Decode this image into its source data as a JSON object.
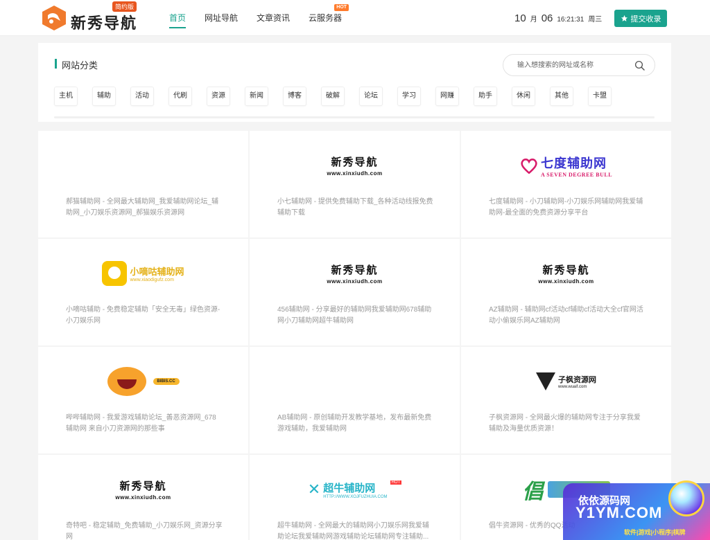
{
  "header": {
    "logo_text": "新秀导航",
    "logo_badge": "简约版",
    "nav": [
      {
        "label": "首页",
        "active": true,
        "hot": false
      },
      {
        "label": "网址导航",
        "active": false,
        "hot": false
      },
      {
        "label": "文章资讯",
        "active": false,
        "hot": false
      },
      {
        "label": "云服务器",
        "active": false,
        "hot": true
      }
    ],
    "hot_label": "HOT",
    "clock": {
      "month": "10",
      "month_unit": "月",
      "day": "06",
      "time": "16:21:31",
      "weekday": "周三"
    },
    "submit_label": "提交收录",
    "accent_color": "#1aa38e"
  },
  "categories": {
    "title": "网站分类",
    "search_placeholder": "输入想搜索的网址或名称",
    "tags": [
      "主机",
      "辅助",
      "活动",
      "代刷",
      "资源",
      "新闻",
      "博客",
      "破解",
      "论坛",
      "学习",
      "网赚",
      "助手",
      "休闲",
      "其他",
      "卡盟"
    ]
  },
  "sites": [
    {
      "logo": "",
      "desc": "郝猫辅助网 - 全网最大辅助网_我爱辅助网论坛_辅助网_小刀娱乐资源网_郝猫娱乐资源网"
    },
    {
      "logo": "xinxiu",
      "desc": "小七辅助网 - 提供免费辅助下载_各种活动线报免费辅助下载"
    },
    {
      "logo": "sevendegree",
      "desc": "七度辅助网 - 小刀辅助网-小刀娱乐网辅助网我爱辅助网-最全面的免费资源分享平台"
    },
    {
      "logo": "xiaodigu",
      "desc": "小嘀咕辅助 - 免费稳定辅助「安全无毒」绿色资源-小刀娱乐网"
    },
    {
      "logo": "xinxiu",
      "desc": "456辅助网 - 分享最好的辅助网我爱辅助网678辅助网小刀辅助网超牛辅助网"
    },
    {
      "logo": "xinxiu",
      "desc": "AZ辅助网 - 辅助网cf活动cf辅助cf活动大全cf官网活动小偷娱乐网AZ辅助网"
    },
    {
      "logo": "bibis",
      "desc": "哔哔辅助网 - 我爱游戏辅助论坛_善恶资源网_678辅助网 来自小刀资源网的那些事"
    },
    {
      "logo": "",
      "desc": "AB辅助网 - 原创辅助开发教学基地，发布最新免费游戏辅助，我爱辅助网"
    },
    {
      "logo": "zifeng",
      "desc": "子枫资源网 - 全网最火爆的辅助网专注于分享我爱辅助及海量优质资源！"
    },
    {
      "logo": "xinxiu",
      "desc": "奇特吧 - 稳定辅助_免费辅助_小刀娱乐网_资源分享网"
    },
    {
      "logo": "chaoniu",
      "desc": "超牛辅助网 - 全网最大的辅助网小刀娱乐网我爱辅助论坛我爱辅助网游戏辅助论坛辅助网专注辅助..."
    },
    {
      "logo": "jiniu",
      "desc": "倡牛资源网 - 优秀的QQ活动"
    }
  ],
  "brands": {
    "xinxiu": {
      "cn": "新秀导航",
      "url": "www.xinxiudh.com"
    },
    "sevendegree": {
      "cn": "七度辅助网",
      "en": "A SEVEN DEGREE BULL"
    },
    "xiaodigu": {
      "cn": "小嘀咕辅助网",
      "url": "www.xiaodigufz.com"
    },
    "bibis": {
      "tag": "BIBIS.CC"
    },
    "zifeng": {
      "cn": "子枫资源网",
      "url": "www.wuaif.com"
    },
    "chaoniu": {
      "cn": "超牛辅助网",
      "url": "HTTP://WWW.XOJFUZHUIA.COM",
      "hot": "HOT"
    }
  },
  "watermark": {
    "line1": "依依源码网",
    "line2": "Y1YM.COM",
    "line3": "软件|游戏|小程序|棋牌"
  }
}
